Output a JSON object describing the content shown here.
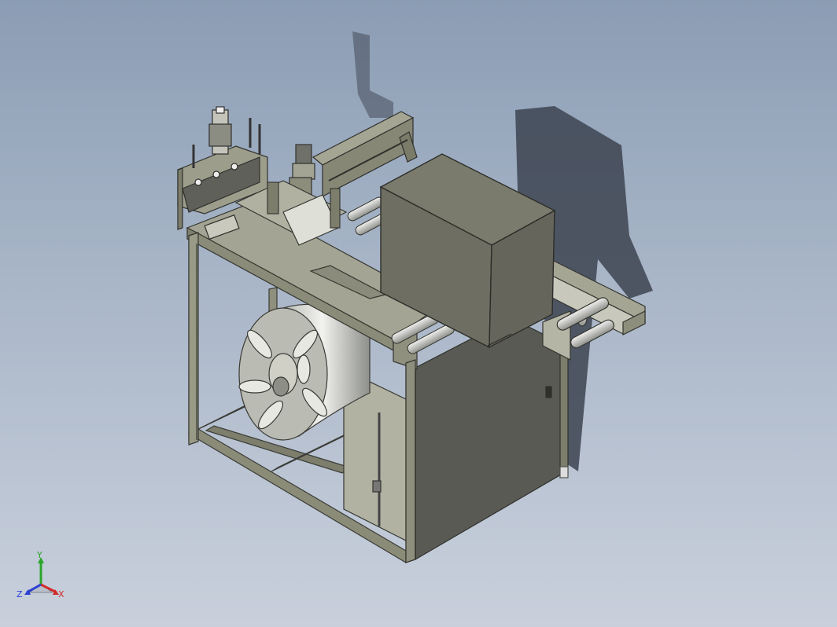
{
  "viewport": {
    "background_top": "#8b9db4",
    "background_bottom": "#c9d0dc",
    "model": "isometric-machine-assembly"
  },
  "triad": {
    "x_label": "X",
    "y_label": "Y",
    "z_label": "Z",
    "x_color": "#d12b2b",
    "y_color": "#2aa52a",
    "z_color": "#2b3fd1"
  }
}
